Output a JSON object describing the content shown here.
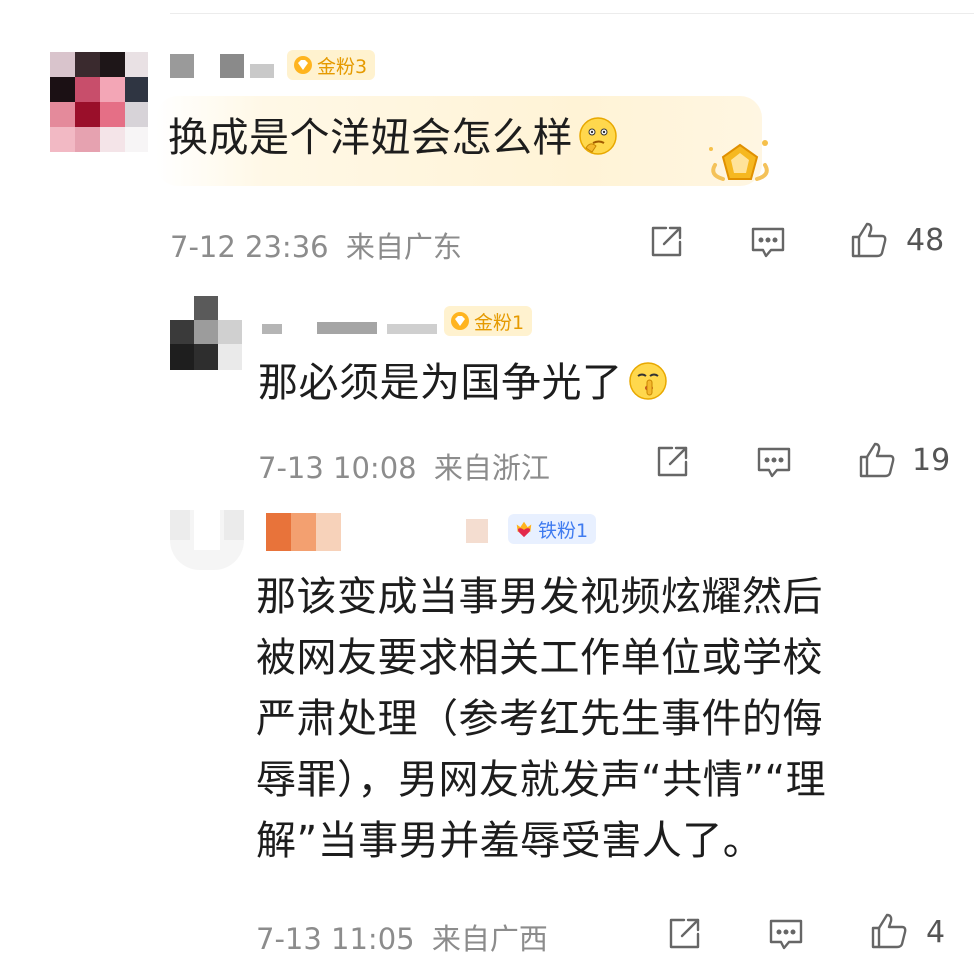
{
  "comments": [
    {
      "badge": "金粉3",
      "text": "换成是个洋妞会怎么样",
      "time": "7-12 23:36",
      "location": "来自广东",
      "likes": "48"
    },
    {
      "badge": "金粉1",
      "text": "那必须是为国争光了",
      "time": "7-13 10:08",
      "location": "来自浙江",
      "likes": "19"
    },
    {
      "badge": "铁粉1",
      "text_lines": [
        "那该变成当事男发视频炫耀然后",
        "被网友要求相关工作单位或学校",
        "严肃处理（参考红先生事件的侮",
        "辱罪），男网友就发声“共情”“理",
        "解”当事男并羞辱受害人了。"
      ],
      "time": "7-13 11:05",
      "location": "来自广西",
      "likes": "4"
    }
  ],
  "icons": {
    "share": "share-icon",
    "comment": "comment-icon",
    "like": "like-icon",
    "badge_gold": "diamond-icon",
    "badge_iron": "heart-crown-icon"
  },
  "colors": {
    "gold_badge_bg": "#fff2cf",
    "gold_badge_text": "#e59a00",
    "iron_badge_bg": "#e8f0ff",
    "iron_badge_text": "#3f7bf0",
    "meta_text": "#8c8c8c"
  }
}
